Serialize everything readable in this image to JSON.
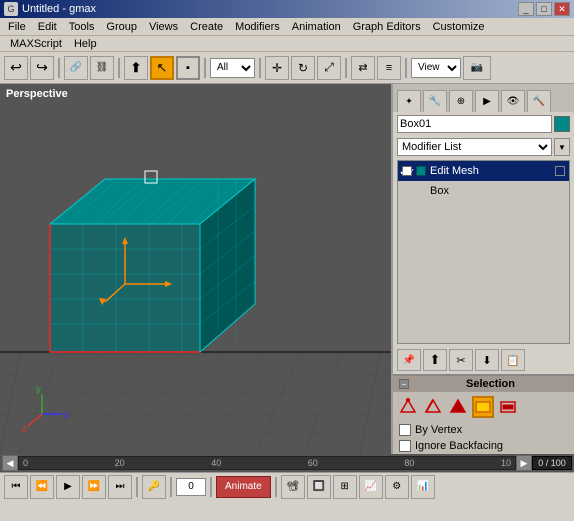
{
  "titleBar": {
    "title": "Untitled - gmax",
    "icon": "G",
    "minimizeLabel": "_",
    "maximizeLabel": "□",
    "closeLabel": "✕"
  },
  "menuBar": {
    "items": [
      "File",
      "Edit",
      "Tools",
      "Group",
      "Views",
      "Create",
      "Modifiers",
      "Animation",
      "Graph Editors",
      "Customize",
      "MAXScript",
      "Help"
    ]
  },
  "toolbar": {
    "selectMode": "All",
    "viewMode": "View"
  },
  "viewport": {
    "label": "Perspective"
  },
  "rightPanel": {
    "objectName": "Box01",
    "modifierListLabel": "Modifier List",
    "modifierStack": [
      {
        "name": "Edit Mesh",
        "selected": true,
        "checked": true
      },
      {
        "name": "Box",
        "selected": false,
        "checked": false
      }
    ]
  },
  "selectionSection": {
    "title": "Selection",
    "byVertexLabel": "By Vertex",
    "ignoreBackfacingLabel": "Ignore Backfacing"
  },
  "timeline": {
    "frameCounter": "0 / 100",
    "ticks": [
      "0",
      "20",
      "40",
      "60",
      "80",
      "10"
    ]
  },
  "bottomBar": {
    "animateLabel": "Animate"
  },
  "stackButtons": [
    "📌",
    "⬆",
    "⬇",
    "✂",
    "📋"
  ]
}
